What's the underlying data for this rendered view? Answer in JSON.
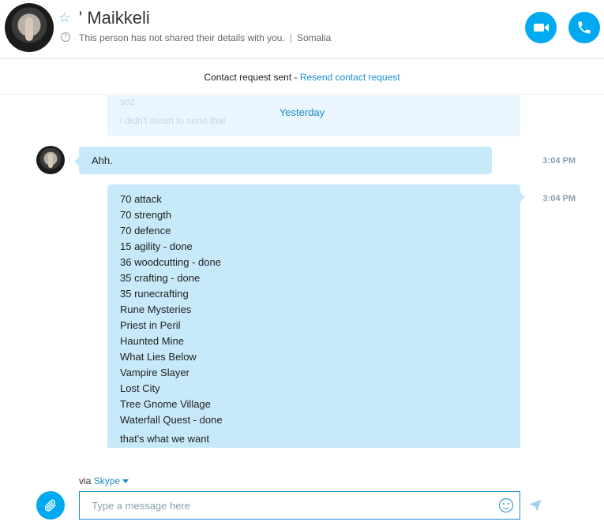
{
  "header": {
    "contact_name": "' Maikkeli",
    "status_text": "This person has not shared their details with you.",
    "location": "Somalia"
  },
  "request_bar": {
    "text": "Contact request sent - ",
    "link": "Resend contact request"
  },
  "conversation": {
    "faded_lines": [
      "soz",
      "i didn't mean to send that"
    ],
    "date_separator": "Yesterday",
    "messages": [
      {
        "direction": "incoming",
        "text": "Ahh.",
        "time": "3:04 PM"
      },
      {
        "direction": "outgoing",
        "lines": [
          "70 attack",
          "70 strength",
          "70 defence",
          "15 agility - done",
          "36 woodcutting - done",
          "35 crafting - done",
          "35 runecrafting",
          "Rune Mysteries",
          "Priest in Peril",
          "Haunted Mine",
          "What Lies Below",
          "Vampire Slayer",
          "Lost City",
          "Tree Gnome Village",
          "Waterfall Quest - done"
        ],
        "last_line": "that's what we want",
        "time": "3:04 PM"
      }
    ]
  },
  "compose": {
    "via_label": "via",
    "service": "Skype",
    "placeholder": "Type a message here"
  },
  "icons": {
    "favorite": "star-outline-icon",
    "info": "question-circle-icon",
    "video": "video-camera-icon",
    "call": "phone-icon",
    "attach": "paperclip-icon",
    "emoji": "smiley-icon",
    "send": "paper-plane-icon"
  },
  "colors": {
    "accent": "#00a9f0",
    "link": "#1a8ccb",
    "bubble": "#c7e9f9",
    "timestamp": "#8aa0ae"
  }
}
